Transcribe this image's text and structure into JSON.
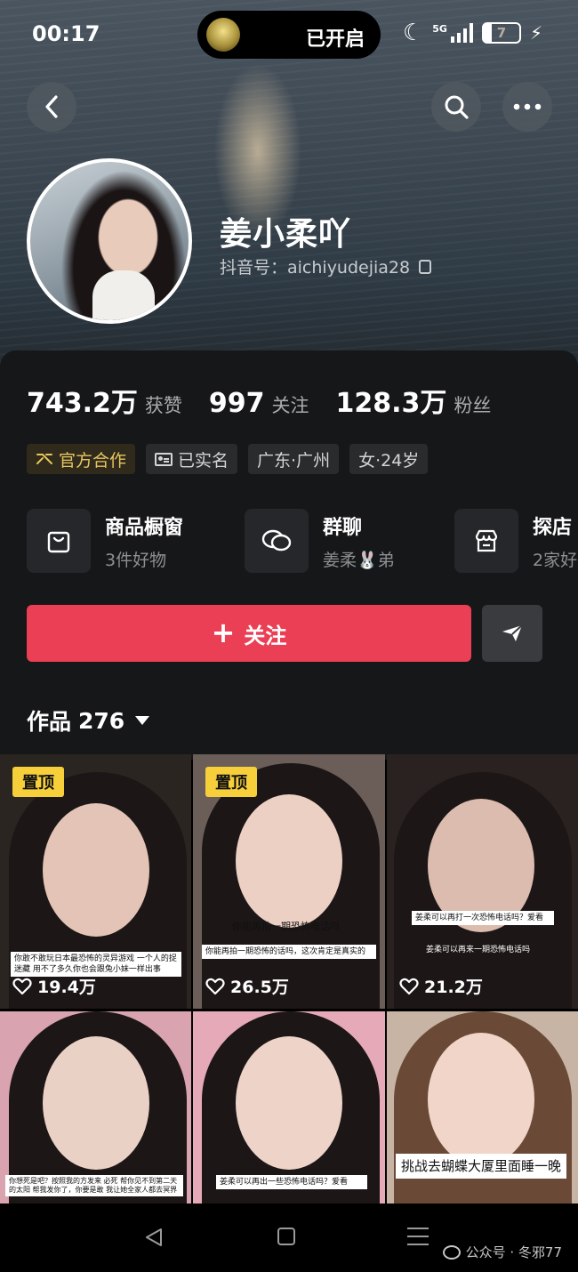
{
  "status_bar": {
    "time": "00:17",
    "island_text": "已开启",
    "network": "5G",
    "battery": "7"
  },
  "profile": {
    "nickname": "姜小柔吖",
    "douyin_id": "抖音号：aichiyudejia28"
  },
  "stats": [
    {
      "value": "743.2万",
      "label": "获赞"
    },
    {
      "value": "997",
      "label": "关注"
    },
    {
      "value": "128.3万",
      "label": "粉丝"
    }
  ],
  "tags": [
    {
      "label": "官方合作",
      "icon": "official-cooperation-icon"
    },
    {
      "label": "已实名",
      "icon": "id-card-icon"
    },
    {
      "label": "广东·广州"
    },
    {
      "label": "女·24岁"
    }
  ],
  "features": [
    {
      "title": "商品橱窗",
      "sub": "3件好物",
      "icon": "shopping-bag-icon"
    },
    {
      "title": "群聊",
      "sub": "姜柔🐰弟",
      "icon": "chat-bubble-icon"
    },
    {
      "title": "探店",
      "sub": "2家好",
      "icon": "store-icon"
    }
  ],
  "actions": {
    "follow_label": "关注"
  },
  "works": {
    "label": "作品",
    "count": "276"
  },
  "videos": [
    {
      "pinned": "置顶",
      "likes": "19.4万",
      "caption": "你敢不敢玩日本最恐怖的灵异游戏 一个人的捉迷藏 用不了多久你也会跟兔小妹一样出事"
    },
    {
      "pinned": "置顶",
      "likes": "26.5万",
      "caption_top": "你能再拍一期恐怖电话吗",
      "caption": "你能再拍一期恐怖的话吗，这次肯定是真实的"
    },
    {
      "likes": "21.2万",
      "caption_top": "姜柔可以再打一次恐怖电话吗？爱看",
      "caption": "姜柔可以再来一期恐怖电话吗"
    },
    {
      "caption": "你想死是吧？按照我的方发来 必死 帮你见不到第二天的太阳 帮我发你了，你要是敢 我让她全家人都去冥界"
    },
    {
      "caption": "姜柔可以再出一些恐怖电话吗？爱看"
    },
    {
      "caption": "挑战去蝴蝶大厦里面睡一晚"
    }
  ],
  "watermark": "公众号 · 冬邪77",
  "colors": {
    "follow_button": "#ea3f55",
    "official_tag": "#e7c660",
    "pin_badge": "#f7cf3b",
    "panel_bg": "#161718"
  }
}
